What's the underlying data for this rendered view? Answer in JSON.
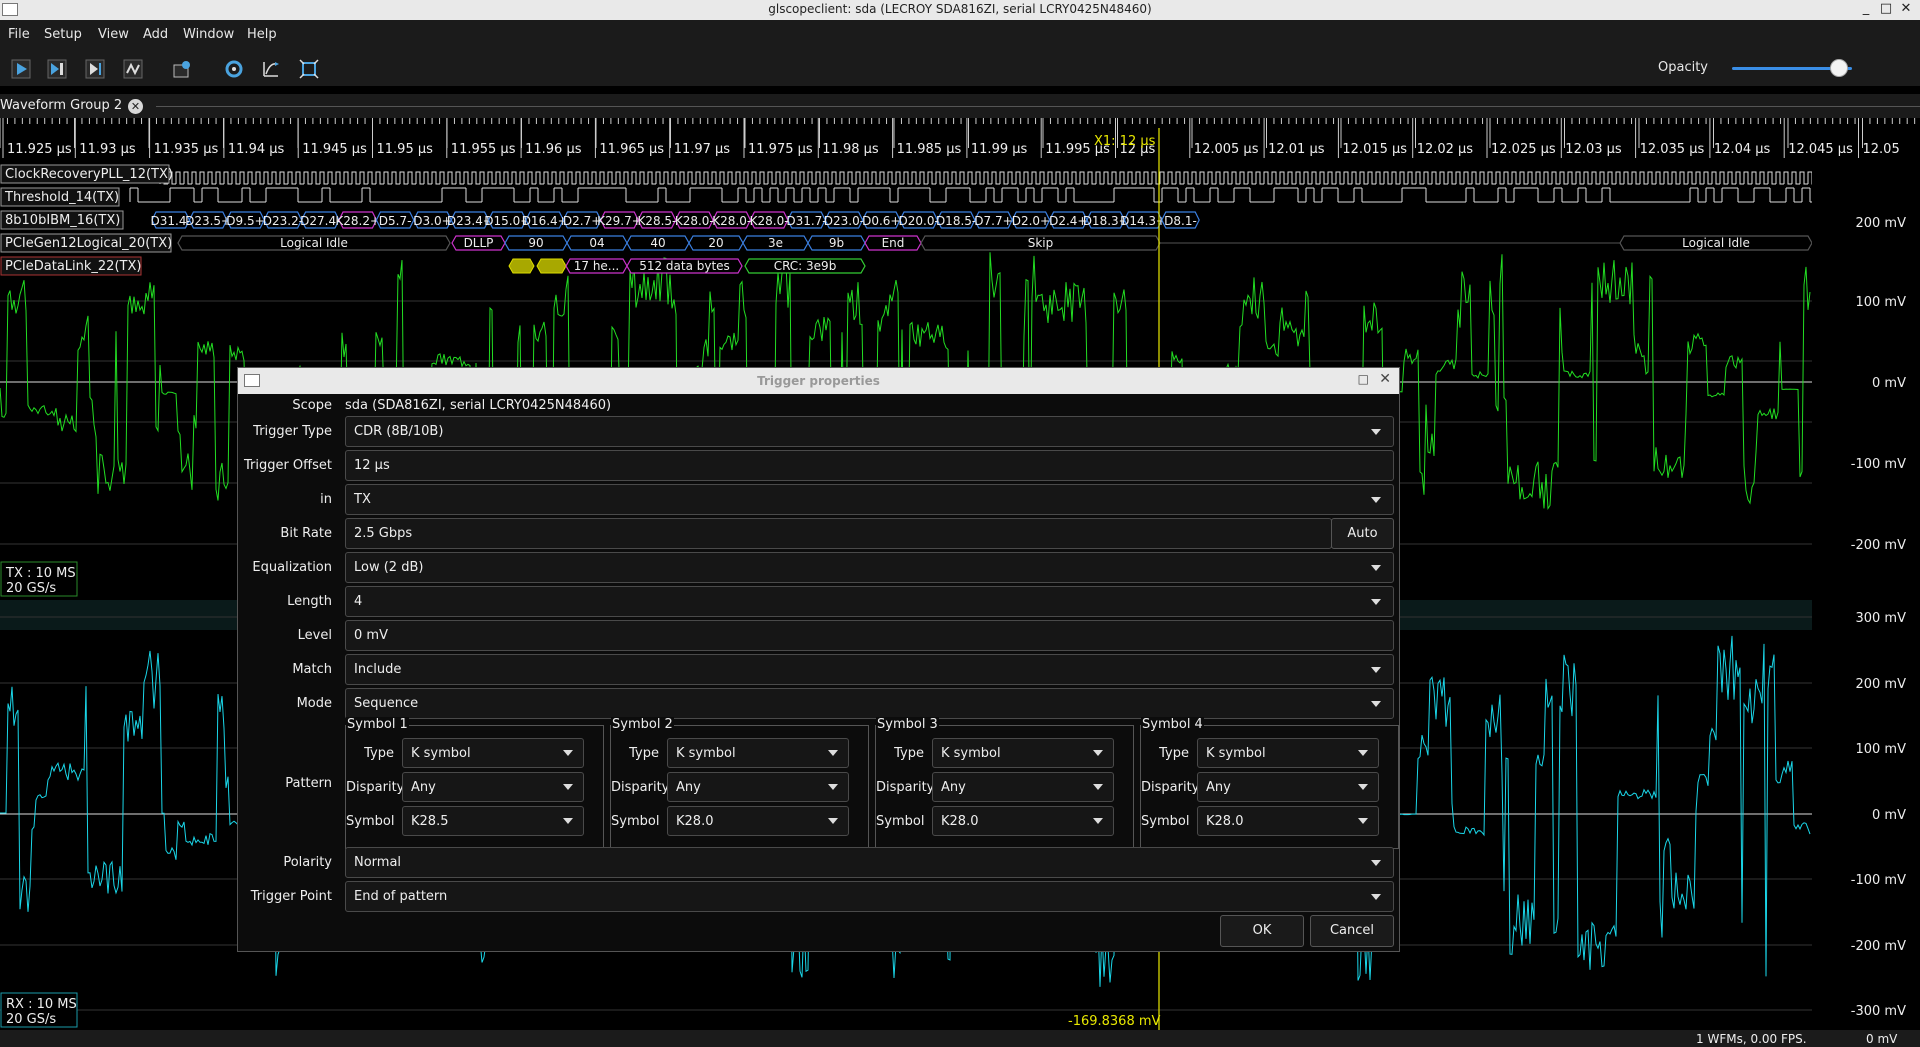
{
  "window": {
    "title": "glscopeclient: sda (LECROY SDA816ZI, serial LCRY0425N48460)"
  },
  "menu": [
    "File",
    "Setup",
    "View",
    "Add",
    "Window",
    "Help"
  ],
  "toolbar": {
    "icons": [
      "start-trigger-icon",
      "single-trigger-icon",
      "force-trigger-icon",
      "stop-trigger-icon",
      "history-icon",
      "refresh-icon",
      "fullscreen-icon",
      "zoom-fit-icon"
    ],
    "opacity_label": "Opacity",
    "opacity_value": 0.82
  },
  "tab": {
    "label": "Waveform Group 2"
  },
  "timeline": {
    "ticks": [
      "11.925 µs",
      "11.93 µs",
      "11.935 µs",
      "11.94 µs",
      "11.945 µs",
      "11.95 µs",
      "11.955 µs",
      "11.96 µs",
      "11.965 µs",
      "11.97 µs",
      "11.975 µs",
      "11.98 µs",
      "11.985 µs",
      "11.99 µs",
      "11.995 µs",
      "12 µs",
      "12.005 µs",
      "12.01 µs",
      "12.015 µs",
      "12.02 µs",
      "12.025 µs",
      "12.03 µs",
      "12.035 µs",
      "12.04 µs",
      "12.045 µs",
      "12.05"
    ],
    "cursor_label": "X1: 12 µs"
  },
  "channels": {
    "clock": "ClockRecoveryPLL_12(TX)",
    "threshold": "Threshold_14(TX)",
    "decode8b10b": "8b10bIBM_16(TX)",
    "logical": "PCIeGen12Logical_20(TX)",
    "datalink": "PCIeDataLink_22(TX)"
  },
  "symbols8b10b": [
    {
      "t": "D31.4-",
      "k": false
    },
    {
      "t": "D23.5+",
      "k": false
    },
    {
      "t": "D9.5+",
      "k": false
    },
    {
      "t": "D23.2-",
      "k": false
    },
    {
      "t": "D27.4-",
      "k": false
    },
    {
      "t": "K28.2+",
      "k": true
    },
    {
      "t": "D5.7-",
      "k": false
    },
    {
      "t": "D3.0+",
      "k": false
    },
    {
      "t": "D23.4+",
      "k": false
    },
    {
      "t": "D15.0+",
      "k": false
    },
    {
      "t": "D16.4+",
      "k": false
    },
    {
      "t": "D2.7+",
      "k": false
    },
    {
      "t": "K29.7+",
      "k": true
    },
    {
      "t": "K28.5-",
      "k": true
    },
    {
      "t": "K28.0-",
      "k": true
    },
    {
      "t": "K28.0-",
      "k": true
    },
    {
      "t": "K28.0-",
      "k": true
    },
    {
      "t": "D31.7-",
      "k": false
    },
    {
      "t": "D23.0-",
      "k": false
    },
    {
      "t": "D0.6+",
      "k": false
    },
    {
      "t": "D20.0-",
      "k": false
    },
    {
      "t": "D18.5-",
      "k": false
    },
    {
      "t": "D7.7+",
      "k": false
    },
    {
      "t": "D2.0+",
      "k": false
    },
    {
      "t": "D2.4+",
      "k": false
    },
    {
      "t": "D18.3+",
      "k": false
    },
    {
      "t": "D14.3+",
      "k": false
    },
    {
      "t": "D8.1-",
      "k": false
    }
  ],
  "logical_segments": [
    "Logical Idle",
    "DLLP",
    "90",
    "04",
    "40",
    "20",
    "3e",
    "9b",
    "End",
    "Skip",
    "Logical Idle"
  ],
  "datalink_segments": [
    "17 he...",
    "512 data bytes",
    "CRC: 3e9b"
  ],
  "tx_axis": [
    "200 mV",
    "100 mV",
    "0 mV",
    "-100 mV",
    "-200 mV"
  ],
  "rx_axis": [
    "300 mV",
    "200 mV",
    "100 mV",
    "0 mV",
    "-100 mV",
    "-200 mV",
    "-300 mV"
  ],
  "tx_info": {
    "line1": "TX : 10 MS",
    "line2": "20 GS/s"
  },
  "rx_info": {
    "line1": "RX : 10 MS",
    "line2": "20 GS/s"
  },
  "cursor_readout": "-169.8368 mV",
  "status": {
    "fps": "1 WFMs, 0.00 FPS.",
    "cursor_value": "0 mV"
  },
  "colors": {
    "tx_wave": "#22dd22",
    "rx_wave": "#1ad6e8",
    "cursor": "#e8e800",
    "k_symbol": "#cc33cc",
    "d_symbol": "#3b7fe0"
  },
  "dialog": {
    "title": "Trigger properties",
    "scope_label": "Scope",
    "scope_value": "sda (SDA816ZI, serial LCRY0425N48460)",
    "fields": [
      {
        "label": "Trigger Type",
        "value": "CDR (8B/10B)",
        "dropdown": true
      },
      {
        "label": "Trigger Offset",
        "value": "12 µs",
        "dropdown": false
      },
      {
        "label": "in",
        "value": "TX",
        "dropdown": true
      },
      {
        "label": "Bit Rate",
        "value": "2.5 Gbps",
        "dropdown": false
      },
      {
        "label": "Equalization",
        "value": "Low (2 dB)",
        "dropdown": true
      },
      {
        "label": "Length",
        "value": "4",
        "dropdown": true
      },
      {
        "label": "Level",
        "value": "0 mV",
        "dropdown": false
      },
      {
        "label": "Match",
        "value": "Include",
        "dropdown": true
      },
      {
        "label": "Mode",
        "value": "Sequence",
        "dropdown": true
      }
    ],
    "auto_label": "Auto",
    "pattern_label": "Pattern",
    "symbol_row_labels": [
      "Type",
      "Disparity",
      "Symbol"
    ],
    "symbols": [
      {
        "title": "Symbol 1",
        "type": "K symbol",
        "disparity": "Any",
        "symbol": "K28.5"
      },
      {
        "title": "Symbol 2",
        "type": "K symbol",
        "disparity": "Any",
        "symbol": "K28.0"
      },
      {
        "title": "Symbol 3",
        "type": "K symbol",
        "disparity": "Any",
        "symbol": "K28.0"
      },
      {
        "title": "Symbol 4",
        "type": "K symbol",
        "disparity": "Any",
        "symbol": "K28.0"
      }
    ],
    "polarity_label": "Polarity",
    "polarity_value": "Normal",
    "trigger_point_label": "Trigger Point",
    "trigger_point_value": "End of pattern",
    "ok_label": "OK",
    "cancel_label": "Cancel"
  }
}
